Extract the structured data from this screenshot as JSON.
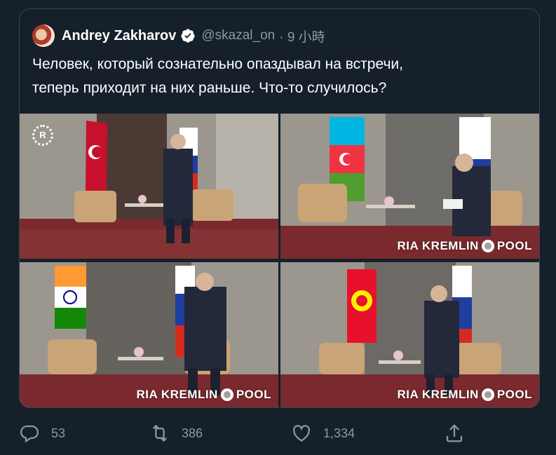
{
  "tweet": {
    "author_name": "Andrey Zakharov",
    "handle": "@skazal_on",
    "time": "· 9 小時",
    "text": "Человек, который сознательно опаздывал на встречи,\nтеперь приходит на них раньше. Что-то случилось?"
  },
  "media": {
    "photos": [
      {
        "watermark_logo": "R",
        "watermark_text": ""
      },
      {
        "watermark_text_a": "RIA KREMLIN",
        "watermark_text_b": "POOL"
      },
      {
        "watermark_text_a": "RIA KREMLIN",
        "watermark_text_b": "POOL"
      },
      {
        "watermark_text_a": "RIA KREMLIN",
        "watermark_text_b": "POOL"
      }
    ]
  },
  "actions": {
    "reply_count": "53",
    "retweet_count": "386",
    "like_count": "1,334"
  },
  "colors": {
    "background": "#15202b",
    "border": "#38444d",
    "secondary_text": "#8899a6",
    "verified_blue": "#1d9bf0"
  }
}
